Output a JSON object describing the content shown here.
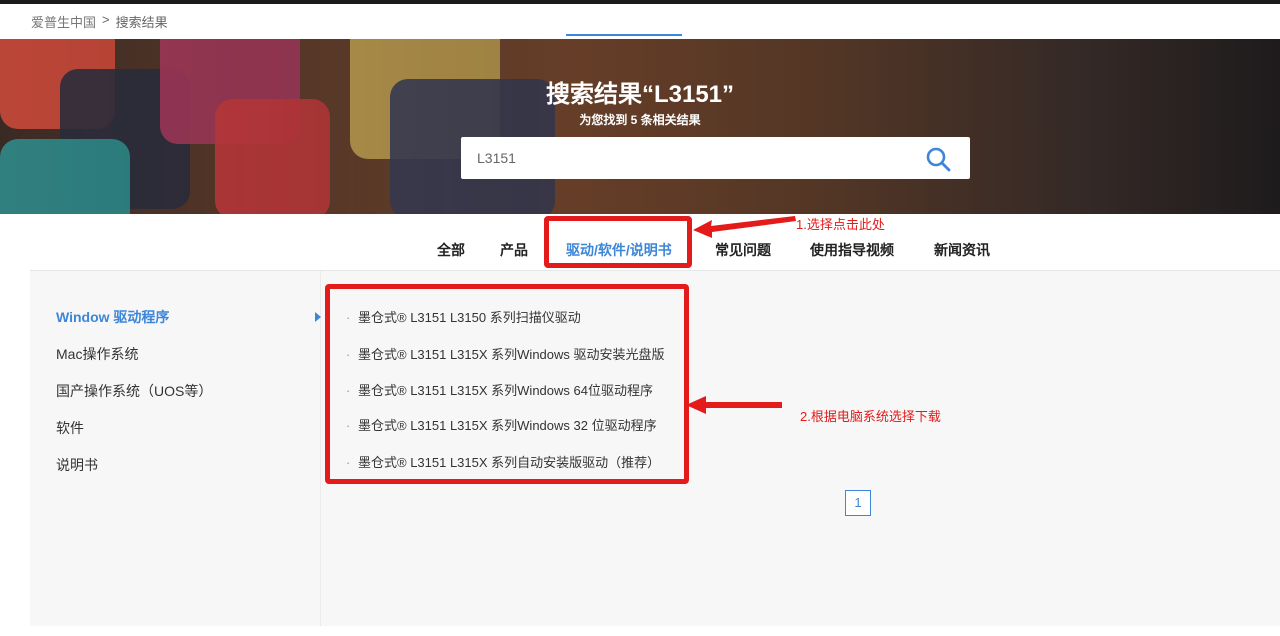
{
  "breadcrumb": {
    "home": "爱普生中国",
    "separator": ">",
    "current": "搜索结果"
  },
  "hero": {
    "title": "搜索结果“L3151”",
    "subtitle": "为您找到 5 条相关结果"
  },
  "search": {
    "value": "L3151",
    "icon": "search-icon"
  },
  "tabs": [
    {
      "label": "全部"
    },
    {
      "label": "产品"
    },
    {
      "label": "驱动/软件/说明书"
    },
    {
      "label": "常见问题"
    },
    {
      "label": "使用指导视频"
    },
    {
      "label": "新闻资讯"
    }
  ],
  "active_tab": "驱动/软件/说明书",
  "sidebar": {
    "items": [
      {
        "label": "Window 驱动程序"
      },
      {
        "label": "Mac操作系统"
      },
      {
        "label": "国产操作系统（UOS等）"
      },
      {
        "label": "软件"
      },
      {
        "label": "说明书"
      }
    ],
    "active": "Window 驱动程序"
  },
  "results": [
    {
      "label": "墨仓式® L3151 L3150 系列扫描仪驱动"
    },
    {
      "label": "墨仓式® L3151 L315X 系列Windows 驱动安装光盘版"
    },
    {
      "label": "墨仓式® L3151 L315X 系列Windows 64位驱动程序"
    },
    {
      "label": "墨仓式® L3151 L315X 系列Windows 32 位驱动程序"
    },
    {
      "label": "墨仓式® L3151 L315X 系列自动安装版驱动（推荐）"
    }
  ],
  "pagination": {
    "current": "1"
  },
  "annotations": {
    "step1": "1.选择点击此处",
    "step2": "2.根据电脑系统选择下载"
  },
  "colors": {
    "accent": "#3d86d8",
    "annotation": "#e31b1b"
  }
}
